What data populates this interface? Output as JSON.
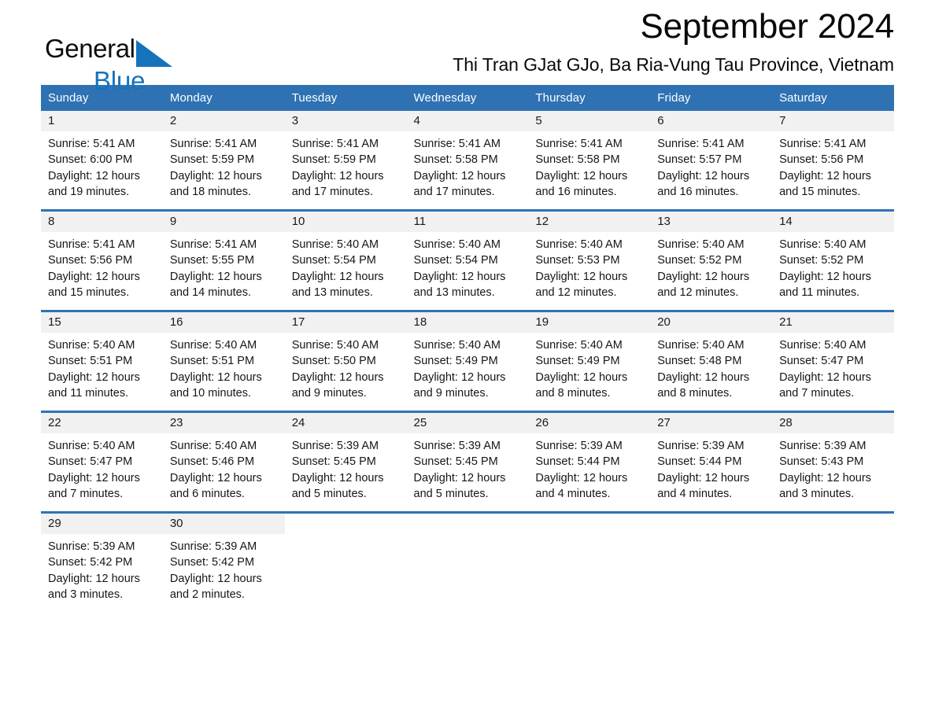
{
  "brand": {
    "name_part1": "General",
    "name_part2": "Blue",
    "logo_icon": "triangle-icon",
    "accent_color": "#1573bc"
  },
  "header": {
    "month_title": "September 2024",
    "location": "Thi Tran GJat GJo, Ba Ria-Vung Tau Province, Vietnam"
  },
  "theme": {
    "header_blue": "#2f72b4",
    "daynum_band": "#f1f1f1",
    "text": "#161616"
  },
  "calendar": {
    "weekday_headers": [
      "Sunday",
      "Monday",
      "Tuesday",
      "Wednesday",
      "Thursday",
      "Friday",
      "Saturday"
    ],
    "weeks": [
      [
        {
          "day": "1",
          "sunrise": "Sunrise: 5:41 AM",
          "sunset": "Sunset: 6:00 PM",
          "daylight_line1": "Daylight: 12 hours",
          "daylight_line2": "and 19 minutes."
        },
        {
          "day": "2",
          "sunrise": "Sunrise: 5:41 AM",
          "sunset": "Sunset: 5:59 PM",
          "daylight_line1": "Daylight: 12 hours",
          "daylight_line2": "and 18 minutes."
        },
        {
          "day": "3",
          "sunrise": "Sunrise: 5:41 AM",
          "sunset": "Sunset: 5:59 PM",
          "daylight_line1": "Daylight: 12 hours",
          "daylight_line2": "and 17 minutes."
        },
        {
          "day": "4",
          "sunrise": "Sunrise: 5:41 AM",
          "sunset": "Sunset: 5:58 PM",
          "daylight_line1": "Daylight: 12 hours",
          "daylight_line2": "and 17 minutes."
        },
        {
          "day": "5",
          "sunrise": "Sunrise: 5:41 AM",
          "sunset": "Sunset: 5:58 PM",
          "daylight_line1": "Daylight: 12 hours",
          "daylight_line2": "and 16 minutes."
        },
        {
          "day": "6",
          "sunrise": "Sunrise: 5:41 AM",
          "sunset": "Sunset: 5:57 PM",
          "daylight_line1": "Daylight: 12 hours",
          "daylight_line2": "and 16 minutes."
        },
        {
          "day": "7",
          "sunrise": "Sunrise: 5:41 AM",
          "sunset": "Sunset: 5:56 PM",
          "daylight_line1": "Daylight: 12 hours",
          "daylight_line2": "and 15 minutes."
        }
      ],
      [
        {
          "day": "8",
          "sunrise": "Sunrise: 5:41 AM",
          "sunset": "Sunset: 5:56 PM",
          "daylight_line1": "Daylight: 12 hours",
          "daylight_line2": "and 15 minutes."
        },
        {
          "day": "9",
          "sunrise": "Sunrise: 5:41 AM",
          "sunset": "Sunset: 5:55 PM",
          "daylight_line1": "Daylight: 12 hours",
          "daylight_line2": "and 14 minutes."
        },
        {
          "day": "10",
          "sunrise": "Sunrise: 5:40 AM",
          "sunset": "Sunset: 5:54 PM",
          "daylight_line1": "Daylight: 12 hours",
          "daylight_line2": "and 13 minutes."
        },
        {
          "day": "11",
          "sunrise": "Sunrise: 5:40 AM",
          "sunset": "Sunset: 5:54 PM",
          "daylight_line1": "Daylight: 12 hours",
          "daylight_line2": "and 13 minutes."
        },
        {
          "day": "12",
          "sunrise": "Sunrise: 5:40 AM",
          "sunset": "Sunset: 5:53 PM",
          "daylight_line1": "Daylight: 12 hours",
          "daylight_line2": "and 12 minutes."
        },
        {
          "day": "13",
          "sunrise": "Sunrise: 5:40 AM",
          "sunset": "Sunset: 5:52 PM",
          "daylight_line1": "Daylight: 12 hours",
          "daylight_line2": "and 12 minutes."
        },
        {
          "day": "14",
          "sunrise": "Sunrise: 5:40 AM",
          "sunset": "Sunset: 5:52 PM",
          "daylight_line1": "Daylight: 12 hours",
          "daylight_line2": "and 11 minutes."
        }
      ],
      [
        {
          "day": "15",
          "sunrise": "Sunrise: 5:40 AM",
          "sunset": "Sunset: 5:51 PM",
          "daylight_line1": "Daylight: 12 hours",
          "daylight_line2": "and 11 minutes."
        },
        {
          "day": "16",
          "sunrise": "Sunrise: 5:40 AM",
          "sunset": "Sunset: 5:51 PM",
          "daylight_line1": "Daylight: 12 hours",
          "daylight_line2": "and 10 minutes."
        },
        {
          "day": "17",
          "sunrise": "Sunrise: 5:40 AM",
          "sunset": "Sunset: 5:50 PM",
          "daylight_line1": "Daylight: 12 hours",
          "daylight_line2": "and 9 minutes."
        },
        {
          "day": "18",
          "sunrise": "Sunrise: 5:40 AM",
          "sunset": "Sunset: 5:49 PM",
          "daylight_line1": "Daylight: 12 hours",
          "daylight_line2": "and 9 minutes."
        },
        {
          "day": "19",
          "sunrise": "Sunrise: 5:40 AM",
          "sunset": "Sunset: 5:49 PM",
          "daylight_line1": "Daylight: 12 hours",
          "daylight_line2": "and 8 minutes."
        },
        {
          "day": "20",
          "sunrise": "Sunrise: 5:40 AM",
          "sunset": "Sunset: 5:48 PM",
          "daylight_line1": "Daylight: 12 hours",
          "daylight_line2": "and 8 minutes."
        },
        {
          "day": "21",
          "sunrise": "Sunrise: 5:40 AM",
          "sunset": "Sunset: 5:47 PM",
          "daylight_line1": "Daylight: 12 hours",
          "daylight_line2": "and 7 minutes."
        }
      ],
      [
        {
          "day": "22",
          "sunrise": "Sunrise: 5:40 AM",
          "sunset": "Sunset: 5:47 PM",
          "daylight_line1": "Daylight: 12 hours",
          "daylight_line2": "and 7 minutes."
        },
        {
          "day": "23",
          "sunrise": "Sunrise: 5:40 AM",
          "sunset": "Sunset: 5:46 PM",
          "daylight_line1": "Daylight: 12 hours",
          "daylight_line2": "and 6 minutes."
        },
        {
          "day": "24",
          "sunrise": "Sunrise: 5:39 AM",
          "sunset": "Sunset: 5:45 PM",
          "daylight_line1": "Daylight: 12 hours",
          "daylight_line2": "and 5 minutes."
        },
        {
          "day": "25",
          "sunrise": "Sunrise: 5:39 AM",
          "sunset": "Sunset: 5:45 PM",
          "daylight_line1": "Daylight: 12 hours",
          "daylight_line2": "and 5 minutes."
        },
        {
          "day": "26",
          "sunrise": "Sunrise: 5:39 AM",
          "sunset": "Sunset: 5:44 PM",
          "daylight_line1": "Daylight: 12 hours",
          "daylight_line2": "and 4 minutes."
        },
        {
          "day": "27",
          "sunrise": "Sunrise: 5:39 AM",
          "sunset": "Sunset: 5:44 PM",
          "daylight_line1": "Daylight: 12 hours",
          "daylight_line2": "and 4 minutes."
        },
        {
          "day": "28",
          "sunrise": "Sunrise: 5:39 AM",
          "sunset": "Sunset: 5:43 PM",
          "daylight_line1": "Daylight: 12 hours",
          "daylight_line2": "and 3 minutes."
        }
      ],
      [
        {
          "day": "29",
          "sunrise": "Sunrise: 5:39 AM",
          "sunset": "Sunset: 5:42 PM",
          "daylight_line1": "Daylight: 12 hours",
          "daylight_line2": "and 3 minutes."
        },
        {
          "day": "30",
          "sunrise": "Sunrise: 5:39 AM",
          "sunset": "Sunset: 5:42 PM",
          "daylight_line1": "Daylight: 12 hours",
          "daylight_line2": "and 2 minutes."
        },
        {
          "day": "",
          "sunrise": "",
          "sunset": "",
          "daylight_line1": "",
          "daylight_line2": "",
          "empty": true
        },
        {
          "day": "",
          "sunrise": "",
          "sunset": "",
          "daylight_line1": "",
          "daylight_line2": "",
          "empty": true
        },
        {
          "day": "",
          "sunrise": "",
          "sunset": "",
          "daylight_line1": "",
          "daylight_line2": "",
          "empty": true
        },
        {
          "day": "",
          "sunrise": "",
          "sunset": "",
          "daylight_line1": "",
          "daylight_line2": "",
          "empty": true
        },
        {
          "day": "",
          "sunrise": "",
          "sunset": "",
          "daylight_line1": "",
          "daylight_line2": "",
          "empty": true
        }
      ]
    ]
  }
}
